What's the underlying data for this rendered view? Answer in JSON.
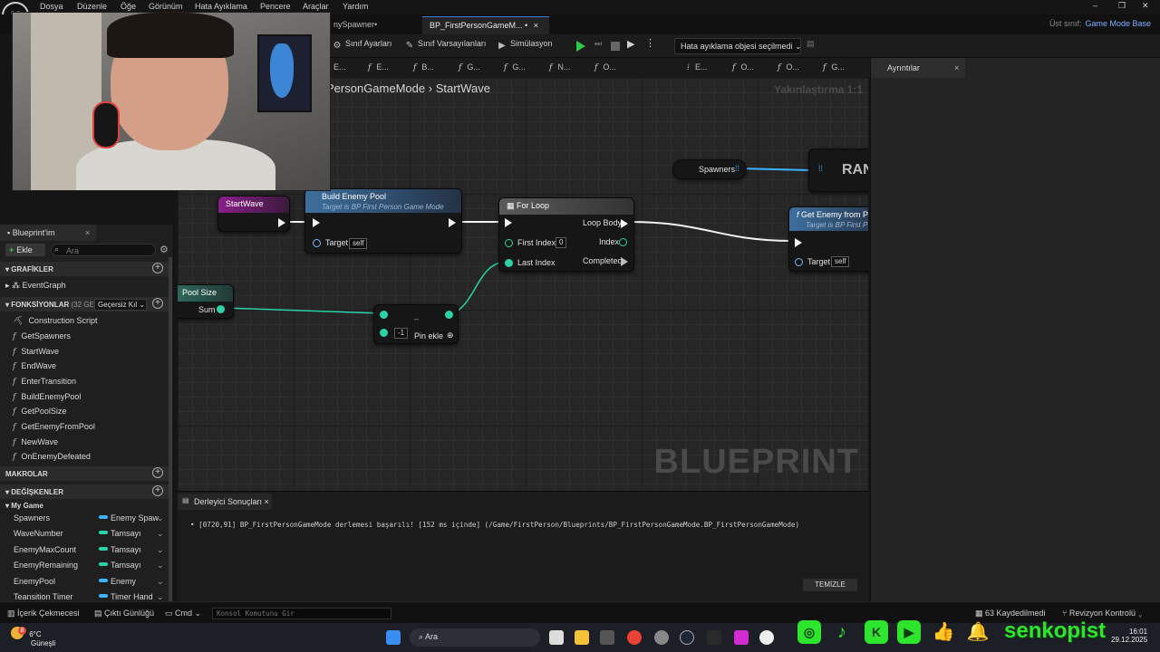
{
  "menu": [
    "Dosya",
    "Düzenle",
    "Öğe",
    "Görünüm",
    "Hata Ayıklama",
    "Pencere",
    "Araçlar",
    "Yardım"
  ],
  "tabs": {
    "spawner": "nySpawner•",
    "active": "BP_FirstPersonGameM... •",
    "close": "×"
  },
  "parent_class": {
    "label": "Üst sınıf:",
    "value": "Game Mode Base"
  },
  "toolbar": {
    "class_settings": "Sınıf Ayarları",
    "class_defaults": "Sınıf Varsayılanları",
    "simulation": "Simülasyon",
    "debug_object": "Hata ayıklama objesi seçilmedi"
  },
  "func_tabs": [
    "E...",
    "E...",
    "B...",
    "G...",
    "G...",
    "N...",
    "O...",
    "E...",
    "O...",
    "O...",
    "G..."
  ],
  "details": {
    "title": "Ayrıntılar",
    "close": "×"
  },
  "graph": {
    "breadcrumb_parent": "PersonGameMode",
    "breadcrumb_sep": "›",
    "breadcrumb_current": "StartWave",
    "zoom": "Yakınlaştırma 1:1",
    "watermark": "BLUEPRINT",
    "nodes": {
      "start_wave": "StartWave",
      "build_pool": {
        "title": "Build Enemy Pool",
        "sub": "Target is BP First Person Game Mode",
        "target": "Target",
        "self": "self"
      },
      "for_loop": {
        "title": "For Loop",
        "first_index": "First Index",
        "first_index_value": "0",
        "last_index": "Last Index",
        "loop_body": "Loop Body",
        "index": "Index",
        "completed": "Completed"
      },
      "spawners": "Spawners",
      "random": "RAN",
      "get_enemy": {
        "title": "Get Enemy from P",
        "sub": "Target is BP First P",
        "target": "Target",
        "self": "self"
      },
      "pool_size": {
        "title": "Pool Size",
        "sum": "Sum"
      },
      "subtract": {
        "value": "-1",
        "symbol": "–",
        "add_pin": "Pin ekle"
      }
    }
  },
  "blueprint_panel": {
    "title": "Blueprint'im",
    "close": "×",
    "add": "Ekle",
    "search_placeholder": "Ara",
    "sections": {
      "graphs": "GRAFİKLER",
      "functions": "FONKSİYONLAR",
      "functions_count": "(32 GEÇ",
      "override": "Geçersiz Kıl",
      "macros": "MAKROLAR",
      "variables": "DEĞİŞKENLER",
      "my_game": "My Game"
    },
    "graphs": [
      "EventGraph"
    ],
    "functions": [
      "Construction Script",
      "GetSpawners",
      "StartWave",
      "EndWave",
      "EnterTransition",
      "BuildEnemyPool",
      "GetPoolSize",
      "GetEnemyFromPool",
      "NewWave",
      "OnEnemyDefeated"
    ],
    "variables": [
      {
        "name": "Spawners",
        "type": "Enemy Spaw",
        "color": "#3fb2ff"
      },
      {
        "name": "WaveNumber",
        "type": "Tamsayı",
        "color": "#2ad3a6"
      },
      {
        "name": "EnemyMaxCount",
        "type": "Tamsayı",
        "color": "#2ad3a6"
      },
      {
        "name": "EnemyRemaining",
        "type": "Tamsayı",
        "color": "#2ad3a6"
      },
      {
        "name": "EnemyPool",
        "type": "Enemy",
        "color": "#3fb2ff"
      },
      {
        "name": "Teansition Timer",
        "type": "Timer Hand",
        "color": "#3fb2ff"
      }
    ]
  },
  "compiler": {
    "tab": "Derleyici Sonuçları",
    "close": "×",
    "message": "[0720,91] BP_FirstPersonGameMode derlemesi başarılı! [152 ms içinde] (/Game/FirstPerson/Blueprints/BP_FirstPersonGameMode.BP_FirstPersonGameMode)",
    "clear": "TEMİZLE"
  },
  "statusbar": {
    "content_drawer": "İçerik Çekmecesi",
    "output_log": "Çıktı Günlüğü",
    "cmd": "Cmd",
    "console_placeholder": "Konsol Komutunu Gir",
    "saved": "63 Kaydedilmedi",
    "revision": "Revizyon Kontrolü"
  },
  "taskbar": {
    "weather_temp": "6°C",
    "weather_desc": "Güneşli",
    "weather_badge": "8",
    "search": "Ara",
    "time": "16:01",
    "date": "29.12.2025"
  },
  "overlay": {
    "brand": "senkopist"
  },
  "colors": {
    "accent": "#3a7bd5",
    "exec": "#f2f2f2",
    "int_pin": "#2ad3a6",
    "object_pin": "#3fb2ff",
    "brand_green": "#2ee52e"
  }
}
